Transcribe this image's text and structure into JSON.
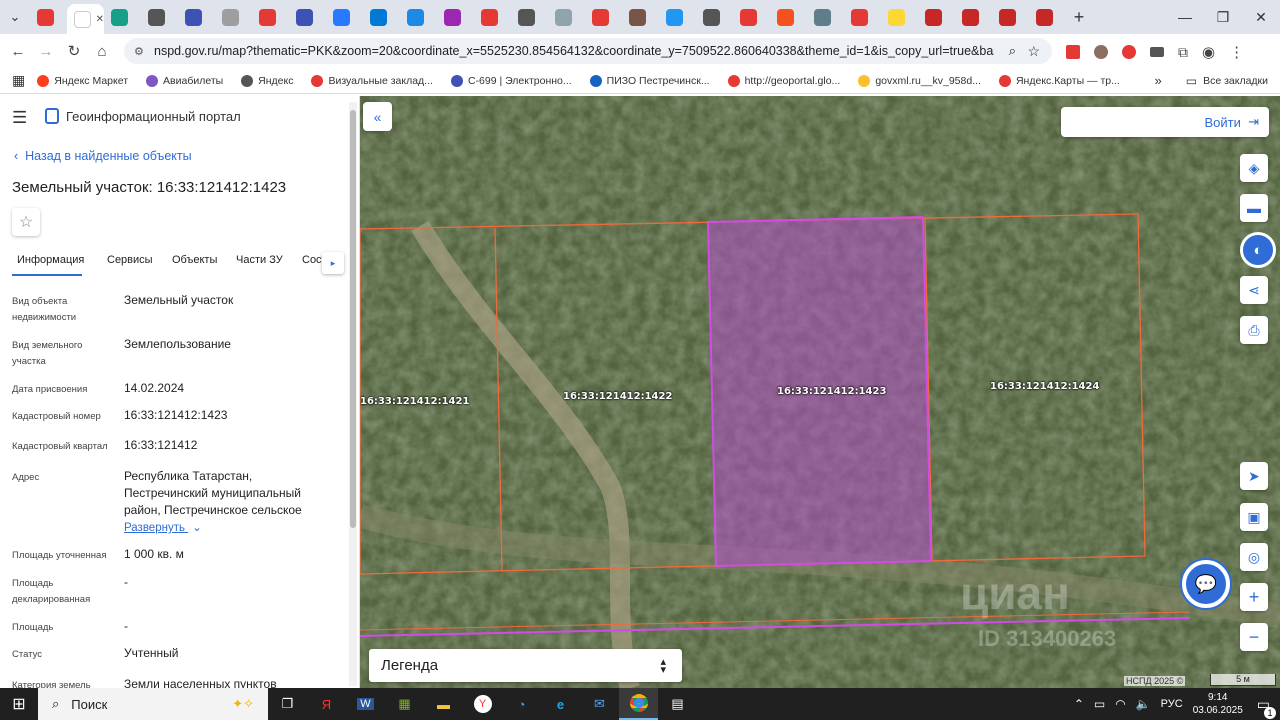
{
  "url": "nspd.gov.ru/map?thematic=PKK&zoom=20&coordinate_x=5525230.854564132&coordinate_y=7509522.860640338&theme_id=1&is_copy_url=true&baseLayerId=363...",
  "tab_colors": [
    "#e53935",
    "#ffffff",
    "#16a085",
    "#555555",
    "#3f51b5",
    "#9e9e9e",
    "#e53935",
    "#3f51b5",
    "#2979ff",
    "#0078d4",
    "#1e88e5",
    "#9c27b0",
    "#e53935",
    "#555555",
    "#90a4ae",
    "#e53935",
    "#795548",
    "#2196f3",
    "#555555",
    "#e53935",
    "#f4511e",
    "#607d8b",
    "#e53935",
    "#fdd835",
    "#c62828",
    "#c62828",
    "#c62828",
    "#c62828"
  ],
  "bookmarks": [
    {
      "label": "Яндекс Маркет",
      "color": "#fc3f1d"
    },
    {
      "label": "Авиабилеты",
      "color": "#7e57c2"
    },
    {
      "label": "Яндекс",
      "color": "#555555"
    },
    {
      "label": "Визуальные заклад...",
      "color": "#e53935"
    },
    {
      "label": "С-699 | Электронно...",
      "color": "#3f51b5"
    },
    {
      "label": "ПИЗО Пестречинск...",
      "color": "#1565c0"
    },
    {
      "label": "http://geoportal.glo...",
      "color": "#e53935"
    },
    {
      "label": "govxml.ru__kv_958d...",
      "color": "#fbc02d"
    },
    {
      "label": "Яндекс.Карты — тр...",
      "color": "#e53935"
    }
  ],
  "bookmarks_all": "Все закладки",
  "panel": {
    "portal_title": "Геоинформационный портал",
    "back_link": "Назад в найденные объекты",
    "object_title": "Земельный участок: 16:33:121412:1423",
    "tabs": [
      "Информация",
      "Сервисы",
      "Объекты",
      "Части ЗУ",
      "Соста"
    ],
    "fields": [
      {
        "label": "Вид объекта недвижимости",
        "value": "Земельный участок"
      },
      {
        "label": "Вид земельного участка",
        "value": "Землепользование"
      },
      {
        "label": "Дата присвоения",
        "value": "14.02.2024"
      },
      {
        "label": "Кадастровый номер",
        "value": "16:33:121412:1423"
      },
      {
        "label": "Кадастровый квартал",
        "value": "16:33:121412"
      },
      {
        "label": "Адрес",
        "value": "Республика Татарстан, Пестречинский муниципальный район, Пестречинское сельское"
      },
      {
        "label": "Площадь уточненная",
        "value": "1 000 кв. м"
      },
      {
        "label": "Площадь декларированная",
        "value": "-"
      },
      {
        "label": "Площадь",
        "value": "-"
      },
      {
        "label": "Статус",
        "value": "Учтенный"
      },
      {
        "label": "Категория земель",
        "value": "Земли населенных пунктов"
      }
    ],
    "expand_link": "Развернуть"
  },
  "map": {
    "parcels": [
      "16:33:121412:1421",
      "16:33:121412:1422",
      "16:33:121412:1423",
      "16:33:121412:1424"
    ],
    "login": "Войти",
    "legend": "Легенда",
    "attribution": "НСПД 2025 ©",
    "scale": "5 м",
    "watermark": "циан",
    "watermark_id": "ID 313400263"
  },
  "taskbar": {
    "search": "Поиск",
    "lang": "РУС",
    "time": "9:14",
    "date": "03.06.2025",
    "notif": "1"
  }
}
